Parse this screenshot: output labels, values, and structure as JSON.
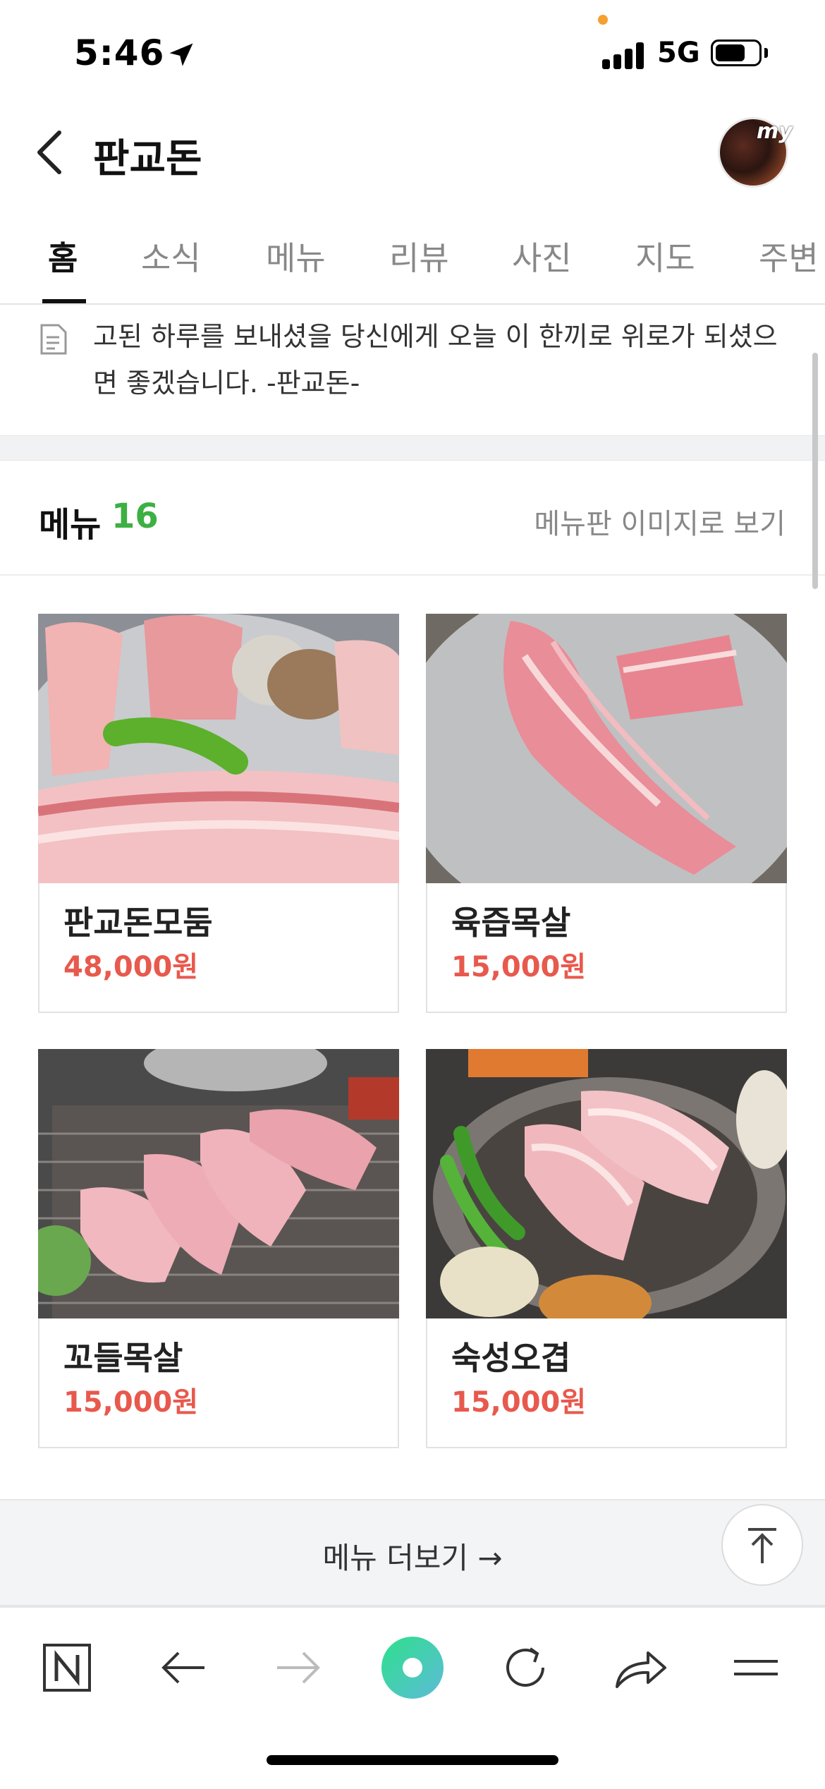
{
  "status_bar": {
    "time": "5:46",
    "network": "5G",
    "battery_level": 0.7
  },
  "header": {
    "title": "판교돈",
    "avatar_badge": "my"
  },
  "tabs": [
    {
      "label": "홈",
      "active": true
    },
    {
      "label": "소식",
      "active": false
    },
    {
      "label": "메뉴",
      "active": false
    },
    {
      "label": "리뷰",
      "active": false
    },
    {
      "label": "사진",
      "active": false
    },
    {
      "label": "지도",
      "active": false
    },
    {
      "label": "주변",
      "active": false
    }
  ],
  "intro": {
    "text": "고된 하루를 보내셨을 당신에게 오늘 이 한끼로 위로가 되셨으면 좋겠습니다. -판교돈-"
  },
  "menu": {
    "label": "메뉴",
    "count": "16",
    "image_link": "메뉴판 이미지로 보기",
    "items": [
      {
        "name": "판교돈모둠",
        "price": "48,000원"
      },
      {
        "name": "육즙목살",
        "price": "15,000원"
      },
      {
        "name": "꼬들목살",
        "price": "15,000원"
      },
      {
        "name": "숙성오겹",
        "price": "15,000원"
      }
    ],
    "more_label": "메뉴 더보기 →"
  },
  "colors": {
    "accent_green": "#3cb043",
    "price_red": "#e8594d",
    "naver_green": "#2fd17a"
  },
  "toolbar": {
    "icons": [
      "naver-n-icon",
      "back-arrow-icon",
      "forward-arrow-icon",
      "green-dot-icon",
      "refresh-icon",
      "share-icon",
      "menu-icon"
    ]
  }
}
